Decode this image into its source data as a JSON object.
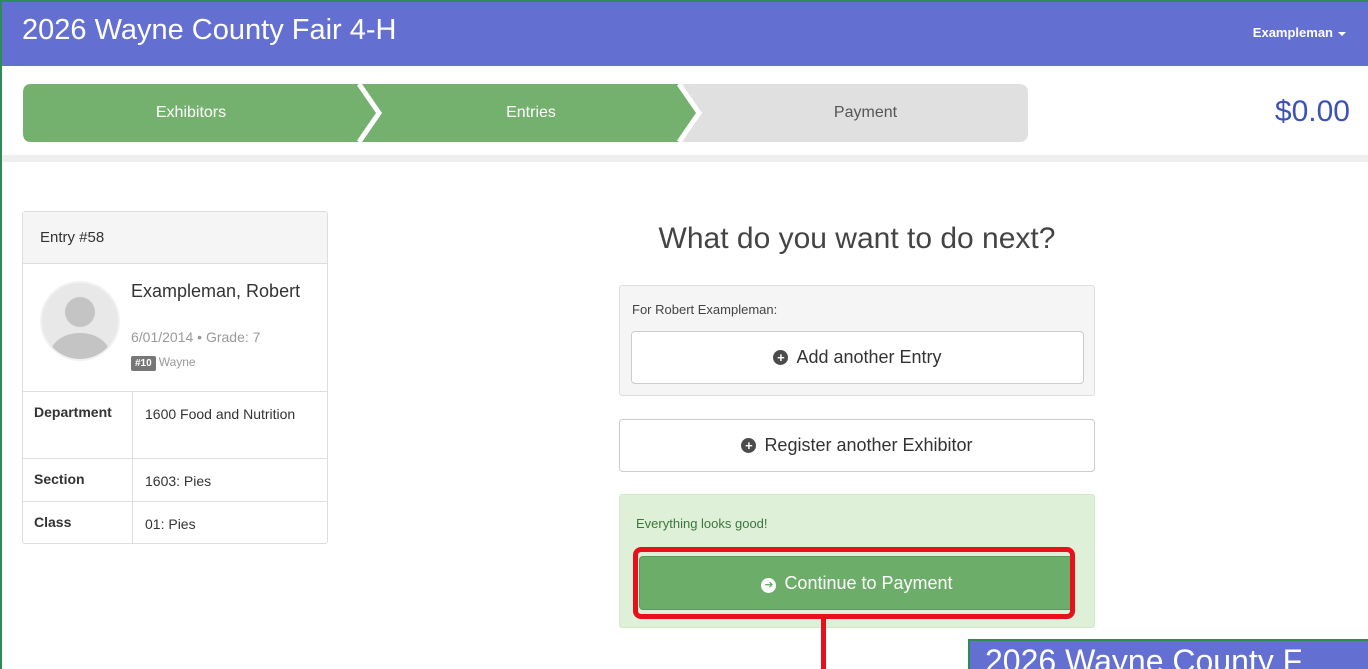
{
  "app": {
    "title": "2026 Wayne County Fair 4-H",
    "user_menu": "Exampleman"
  },
  "steps": [
    {
      "label": "Exhibitors",
      "state": "complete"
    },
    {
      "label": "Entries",
      "state": "complete"
    },
    {
      "label": "Payment",
      "state": "pending"
    }
  ],
  "cart_total": "$0.00",
  "entry": {
    "header": "Entry #58",
    "name": "Exampleman, Robert",
    "birth_grade": "6/01/2014 • Grade: 7",
    "club_badge": "#10",
    "club_name": "Wayne",
    "details": [
      {
        "key": "Department",
        "value": "1600 Food and Nutrition"
      },
      {
        "key": "Section",
        "value": "1603: Pies"
      },
      {
        "key": "Class",
        "value": "01: Pies"
      }
    ]
  },
  "next": {
    "heading": "What do you want to do next?",
    "for_label": "For Robert Exampleman:",
    "add_entry_label": "Add another Entry",
    "register_label": "Register another Exhibitor",
    "status_text": "Everything looks good!",
    "continue_label": "Continue to Payment"
  },
  "peek_title": "2026 Wayne County F",
  "colors": {
    "navbar": "#6470d1",
    "step_complete": "#74b06e",
    "step_pending": "#e0e0e0",
    "highlight": "#e8101a",
    "success_bg": "#dff0d8",
    "continue_button": "#6cad6a"
  },
  "icons": {
    "user_caret": "caret-down-icon",
    "add_entry": "plus-circle-icon",
    "register": "plus-circle-icon",
    "continue": "arrow-circle-right-icon"
  }
}
